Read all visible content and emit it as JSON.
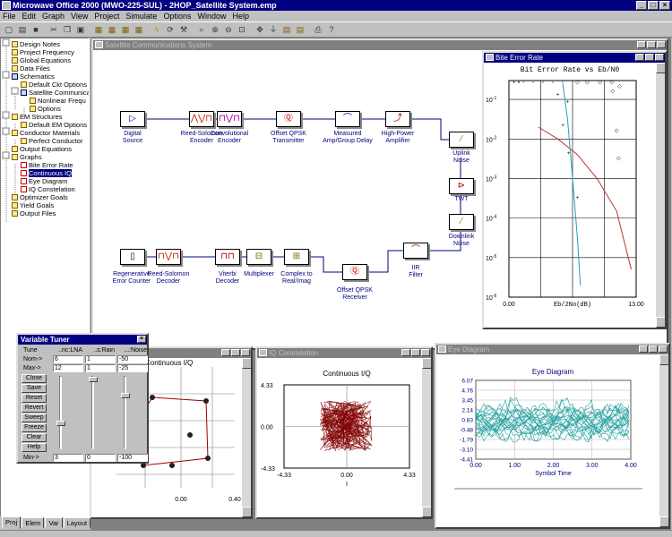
{
  "app": {
    "title": "Microwave Office 2000 (MWO-225-SUL) - 2HOP_Satellite System.emp",
    "menu": [
      "File",
      "Edit",
      "Graph",
      "View",
      "Project",
      "Simulate",
      "Options",
      "Window",
      "Help"
    ]
  },
  "tree": {
    "items": [
      {
        "label": "Design Notes",
        "level": 0,
        "icon": "note-icon"
      },
      {
        "label": "Project Frequency",
        "level": 0,
        "icon": "folder-icon"
      },
      {
        "label": "Global Equations",
        "level": 0,
        "icon": "folder-icon"
      },
      {
        "label": "Data Files",
        "level": 0,
        "icon": "folder-icon"
      },
      {
        "label": "Schematics",
        "level": 0,
        "icon": "schematic-icon"
      },
      {
        "label": "Default Ckt Options",
        "level": 1,
        "icon": "options-icon"
      },
      {
        "label": "Satellite Communicati",
        "level": 1,
        "icon": "schematic-icon"
      },
      {
        "label": "Nonlinear Frequ",
        "level": 2,
        "icon": "folder-icon"
      },
      {
        "label": "Options",
        "level": 2,
        "icon": "options-icon"
      },
      {
        "label": "EM Structures",
        "level": 0,
        "icon": "folder-icon"
      },
      {
        "label": "Default EM Options",
        "level": 1,
        "icon": "options-icon"
      },
      {
        "label": "Conductor Materials",
        "level": 0,
        "icon": "folder-icon"
      },
      {
        "label": "Perfect Conductor",
        "level": 1,
        "icon": "conductor-icon"
      },
      {
        "label": "Output Equations",
        "level": 0,
        "icon": "folder-icon"
      },
      {
        "label": "Graphs",
        "level": 0,
        "icon": "folder-icon"
      },
      {
        "label": "Bite Error Rate",
        "level": 1,
        "icon": "graph-icon"
      },
      {
        "label": "Continuous IQ",
        "level": 1,
        "icon": "graph-icon",
        "selected": true
      },
      {
        "label": "Eye Diagram",
        "level": 1,
        "icon": "graph-icon"
      },
      {
        "label": "IQ Constelation",
        "level": 1,
        "icon": "graph-icon"
      },
      {
        "label": "Optimizer Goals",
        "level": 0,
        "icon": "folder-icon"
      },
      {
        "label": "Yield Goals",
        "level": 0,
        "icon": "folder-icon"
      },
      {
        "label": "Output Files",
        "level": 0,
        "icon": "folder-icon"
      }
    ],
    "tabs": [
      "Proj",
      "Elem",
      "Var",
      "Layout"
    ]
  },
  "schematic": {
    "title": "Satellite Communications System",
    "blocks": [
      {
        "label": "Digital\nSource"
      },
      {
        "label": "Reed-Solomon\nEncoder"
      },
      {
        "label": "Convolutional\nEncoder"
      },
      {
        "label": "Offset QPSK\nTransmitter"
      },
      {
        "label": "Measured\nAmp/Group Delay"
      },
      {
        "label": "High-Power\nAmplifier"
      },
      {
        "label": "Uplink\nNoise"
      },
      {
        "label": "TWT"
      },
      {
        "label": "Downlink\nNoise"
      },
      {
        "label": "IIR\nFilter"
      },
      {
        "label": "Offset QPSK\nReceiver"
      },
      {
        "label": "Complex to\nReal/Imag"
      },
      {
        "label": "Multiplexer"
      },
      {
        "label": "Viterbi\nDecoder"
      },
      {
        "label": "Reed-Solomon\nDecoder"
      },
      {
        "label": "Regenerative\nError Counter"
      }
    ]
  },
  "ber": {
    "window_title": "Bite Error Rate",
    "chart_title": "Bit Error Rate vs Eb/N0",
    "xlabel": "Eb/2No(dB)",
    "x_ticks": [
      "0.00",
      "13.00"
    ],
    "y_ticks": [
      "10^-1",
      "10^-2",
      "10^-3",
      "10^-4",
      "10^-5",
      "10^-6"
    ]
  },
  "iq_cont": {
    "window_title": "",
    "chart_title": "Continuous I/Q",
    "x_ticks": [
      "0.00",
      "0.40"
    ]
  },
  "iq_const": {
    "window_title": "IQ Constelation",
    "chart_title": "Continuous I/Q",
    "y_ticks": [
      "4.33",
      "0.00",
      "-4.33"
    ],
    "x_ticks": [
      "-4.33",
      "0.00",
      "4.33"
    ],
    "xlabel": "I"
  },
  "eye": {
    "window_title": "Eye Diagram",
    "chart_title": "Eye Diagram",
    "y_ticks": [
      "6.07",
      "4.76",
      "3.45",
      "2.14",
      "0.83",
      "-0.48",
      "-1.79",
      "-3.10",
      "-4.41"
    ],
    "x_ticks": [
      "0.00",
      "1.00",
      "2.00",
      "3.00",
      "4.00"
    ],
    "xlabel": "Symbol Time"
  },
  "tuner": {
    "title": "Variable Tuner",
    "row_labels": [
      "Tune",
      "Nom->",
      "Max->",
      "Min->"
    ],
    "columns": [
      {
        "name": "..nc:LNA",
        "nom": "6",
        "max": "12",
        "min": "3"
      },
      {
        "name": "..s:Rain",
        "nom": "1",
        "max": "1",
        "min": "0"
      },
      {
        "name": "...:Noise",
        "nom": "-50",
        "max": "-25",
        "min": "-100"
      }
    ],
    "buttons": [
      "Close",
      "Save",
      "Reset",
      "Revert",
      "Sweep",
      "Freeze",
      "Clear",
      "Help"
    ]
  },
  "chart_data": [
    {
      "type": "line",
      "title": "Bit Error Rate vs Eb/N0",
      "xlabel": "Eb/2No(dB)",
      "ylabel": "",
      "xlim": [
        0,
        13
      ],
      "ylim": [
        1e-06,
        0.3
      ],
      "yscale": "log",
      "series": [
        {
          "values_xy": [
            [
              3,
              0.02
            ],
            [
              5,
              0.01
            ],
            [
              7,
              0.004
            ],
            [
              9,
              0.001
            ],
            [
              11,
              0.00015
            ],
            [
              12.5,
              5e-06
            ]
          ]
        },
        {
          "values_xy": [
            [
              5.5,
              0.25
            ],
            [
              6.0,
              0.03
            ],
            [
              6.5,
              0.001
            ],
            [
              7.0,
              3e-05
            ],
            [
              7.3,
              2e-06
            ]
          ]
        }
      ]
    },
    {
      "type": "scatter",
      "title": "Continuous I/Q",
      "xlim": [
        -4.33,
        4.33
      ],
      "ylim": [
        -4.33,
        4.33
      ]
    },
    {
      "type": "line",
      "title": "Eye Diagram",
      "xlabel": "Symbol Time",
      "xlim": [
        0,
        4
      ],
      "ylim": [
        -4.41,
        6.07
      ]
    }
  ]
}
